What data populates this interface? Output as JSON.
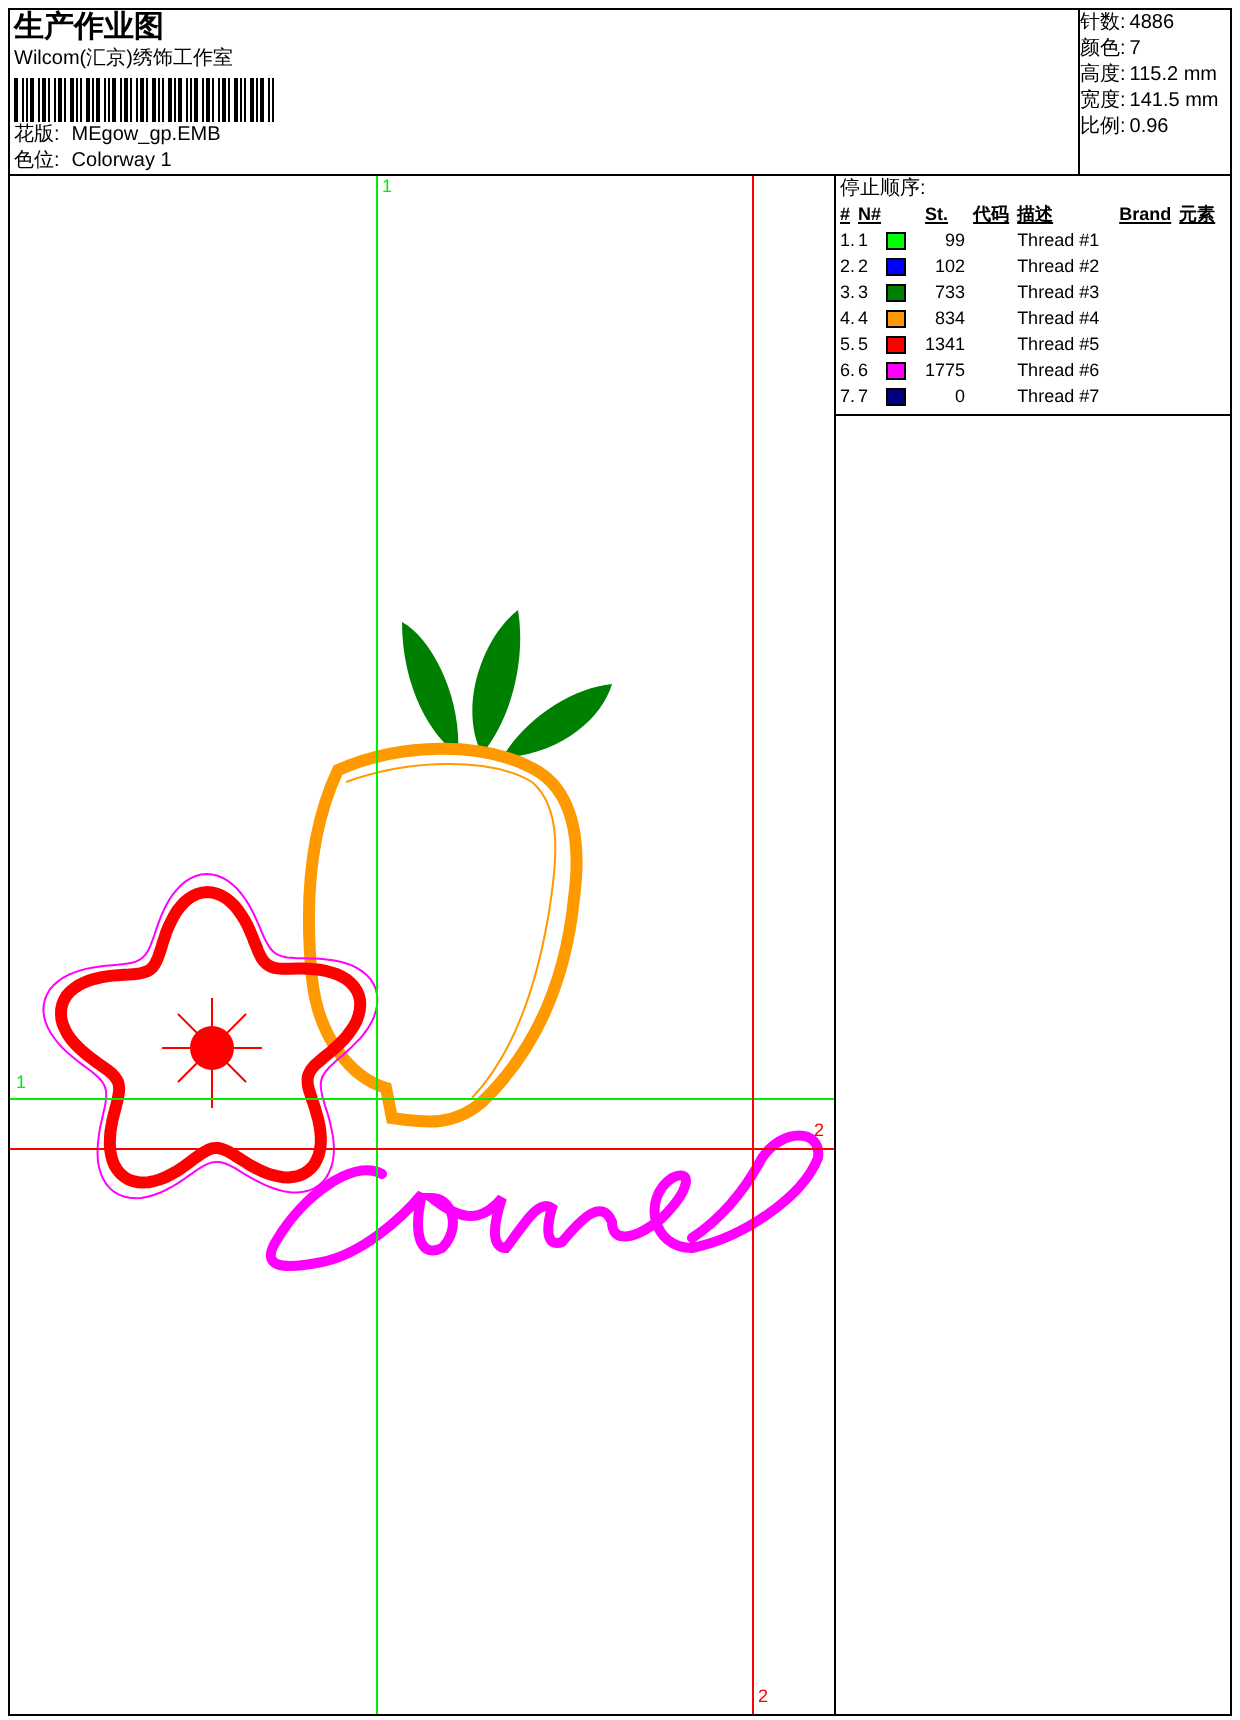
{
  "header": {
    "title": "生产作业图",
    "company": "Wilcom(汇京)绣饰工作室",
    "fields": [
      {
        "label": "花版:",
        "value": "MEgow_gp.EMB"
      },
      {
        "label": "色位:",
        "value": "Colorway 1"
      }
    ]
  },
  "stats": [
    {
      "label": "针数:",
      "value": "4886"
    },
    {
      "label": "颜色:",
      "value": "7"
    },
    {
      "label": "高度:",
      "value": "115.2 mm"
    },
    {
      "label": "宽度:",
      "value": "141.5 mm"
    },
    {
      "label": "比例:",
      "value": "0.96"
    }
  ],
  "canvas": {
    "markers": [
      {
        "kind": "green-top",
        "text": "1"
      },
      {
        "kind": "green-side",
        "text": "1"
      },
      {
        "kind": "red-side",
        "text": "2"
      },
      {
        "kind": "red-bottom",
        "text": "2"
      }
    ]
  },
  "stop_sequence": {
    "title": "停止顺序:",
    "columns": [
      "#",
      "N#",
      "St.",
      "代码",
      "描述",
      "Brand",
      "元素"
    ],
    "rows": [
      {
        "index": "1.",
        "n": "1",
        "color": "#00ff00",
        "st": "99",
        "description": "Thread #1"
      },
      {
        "index": "2.",
        "n": "2",
        "color": "#0000ff",
        "st": "102",
        "description": "Thread #2"
      },
      {
        "index": "3.",
        "n": "3",
        "color": "#008000",
        "st": "733",
        "description": "Thread #3"
      },
      {
        "index": "4.",
        "n": "4",
        "color": "#ff9900",
        "st": "834",
        "description": "Thread #4"
      },
      {
        "index": "5.",
        "n": "5",
        "color": "#ff0000",
        "st": "1341",
        "description": "Thread #5"
      },
      {
        "index": "6.",
        "n": "6",
        "color": "#ff00ff",
        "st": "1775",
        "description": "Thread #6"
      },
      {
        "index": "7.",
        "n": "7",
        "color": "#000080",
        "st": "0",
        "description": "Thread #7"
      }
    ]
  }
}
